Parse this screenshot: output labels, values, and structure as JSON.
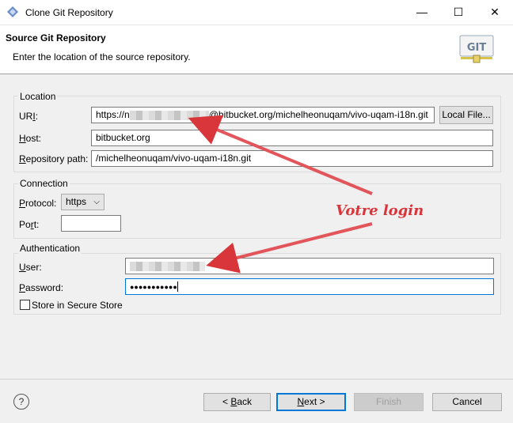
{
  "window": {
    "title": "Clone Git Repository",
    "controls": {
      "minimize": "—",
      "maximize": "☐",
      "close": "✕"
    }
  },
  "header": {
    "title": "Source Git Repository",
    "description": "Enter the location of the source repository.",
    "logo_text": "GIT"
  },
  "location": {
    "group_label": "Location",
    "uri_label": "URI:",
    "uri_prefix": "https://",
    "uri_visible_start": "n",
    "uri_suffix": "@bitbucket.org/michelheonuqam/vivo-uqam-i18n.git",
    "local_file_button": "Local File...",
    "host_label": "Host:",
    "host_value": "bitbucket.org",
    "repo_path_label": "Repository path:",
    "repo_path_value": "/michelheonuqam/vivo-uqam-i18n.git"
  },
  "connection": {
    "group_label": "Connection",
    "protocol_label": "Protocol:",
    "protocol_value": "https",
    "port_label": "Port:",
    "port_value": ""
  },
  "authentication": {
    "group_label": "Authentication",
    "user_label": "User:",
    "password_label": "Password:",
    "password_value": "●●●●●●●●●●●",
    "store_label": "Store in Secure Store",
    "store_checked": false
  },
  "annotation": {
    "text": "Votre login",
    "color": "#d9363b"
  },
  "footer": {
    "help_icon": "?",
    "back_button": "< Back",
    "next_button": "Next >",
    "finish_button": "Finish",
    "cancel_button": "Cancel"
  },
  "colors": {
    "accent": "#0078d7",
    "dialog_bg": "#f0f0f0"
  }
}
